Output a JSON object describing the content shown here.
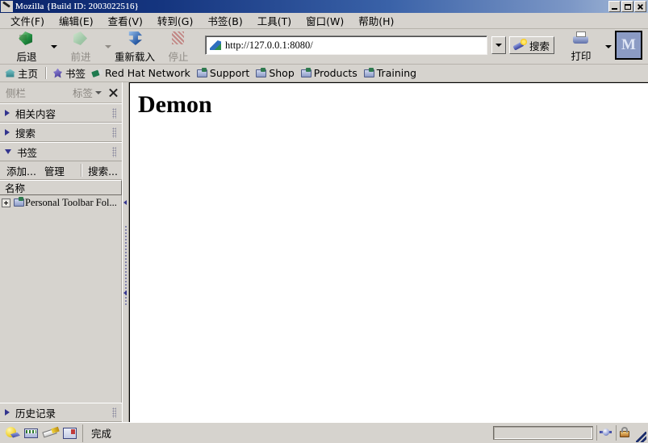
{
  "window": {
    "title": "Mozilla {Build ID: 2003022516}",
    "controls": {
      "minimize": "",
      "maximize": "",
      "close": ""
    }
  },
  "menubar": {
    "items": [
      {
        "label": "文件(F)"
      },
      {
        "label": "编辑(E)"
      },
      {
        "label": "查看(V)"
      },
      {
        "label": "转到(G)"
      },
      {
        "label": "书签(B)"
      },
      {
        "label": "工具(T)"
      },
      {
        "label": "窗口(W)"
      },
      {
        "label": "帮助(H)"
      }
    ]
  },
  "toolbar": {
    "back_label": "后退",
    "forward_label": "前进",
    "reload_label": "重新载入",
    "stop_label": "停止",
    "print_label": "打印",
    "search_label": "搜索",
    "url_value": "http://127.0.0.1:8080/",
    "mozilla_mark": "M"
  },
  "personal_toolbar": {
    "items": [
      {
        "label": "主页",
        "icon": "home-icon"
      },
      {
        "label": "书签",
        "icon": "bookmark-icon"
      },
      {
        "label": "Red Hat Network",
        "icon": "pen-icon"
      },
      {
        "label": "Support",
        "icon": "folder-icon"
      },
      {
        "label": "Shop",
        "icon": "folder-icon"
      },
      {
        "label": "Products",
        "icon": "folder-icon"
      },
      {
        "label": "Training",
        "icon": "folder-icon"
      }
    ]
  },
  "sidebar": {
    "title": "侧栏",
    "tabs_label": "标签",
    "panels": [
      {
        "label": "相关内容",
        "state": "collapsed"
      },
      {
        "label": "搜索",
        "state": "collapsed"
      },
      {
        "label": "书签",
        "state": "expanded"
      }
    ],
    "bookmark_tools": {
      "add_label": "添加...",
      "manage_label": "管理",
      "search_label": "搜索..."
    },
    "column_header": "名称",
    "tree_items": [
      {
        "label": "Personal Toolbar Fol..."
      }
    ],
    "history_panel": {
      "label": "历史记录",
      "state": "collapsed"
    }
  },
  "content": {
    "heading": "Demon"
  },
  "statusbar": {
    "status_text": "完成",
    "component_icons": [
      "navigator-icon",
      "mail-icon",
      "composer-icon",
      "addressbook-icon"
    ],
    "security_icons": [
      "connection-icon",
      "lock-icon"
    ]
  },
  "colors": {
    "chrome": "#d6d3ce",
    "title_active": "#0a246a",
    "page_bg": "#ffffff",
    "twisty_blue": "#33348e"
  }
}
